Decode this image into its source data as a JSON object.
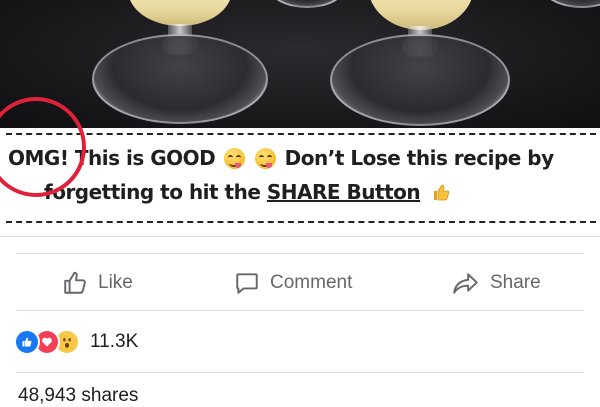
{
  "post": {
    "caption_line1_part1": "OMG! This is GOOD",
    "caption_line1_part2": "Don’t Lose this recipe by",
    "caption_line2_part1": "forgetting to  hit the ",
    "caption_line2_link": "SHARE Button",
    "emoji_1": "yum-face-emoji",
    "emoji_2": "yum-face-emoji",
    "emoji_3": "thumbs-up-emoji"
  },
  "actions": {
    "like_label": "Like",
    "comment_label": "Comment",
    "share_label": "Share"
  },
  "reactions": {
    "types": [
      "like",
      "love",
      "wow"
    ],
    "count": "11.3K"
  },
  "shares_text": "48,943 shares",
  "colors": {
    "icon_gray": "#65676b",
    "like_blue": "#1877f2",
    "love_red": "#f33e58",
    "wow_yellow": "#f7c748",
    "annotation_red": "#e0213a"
  }
}
